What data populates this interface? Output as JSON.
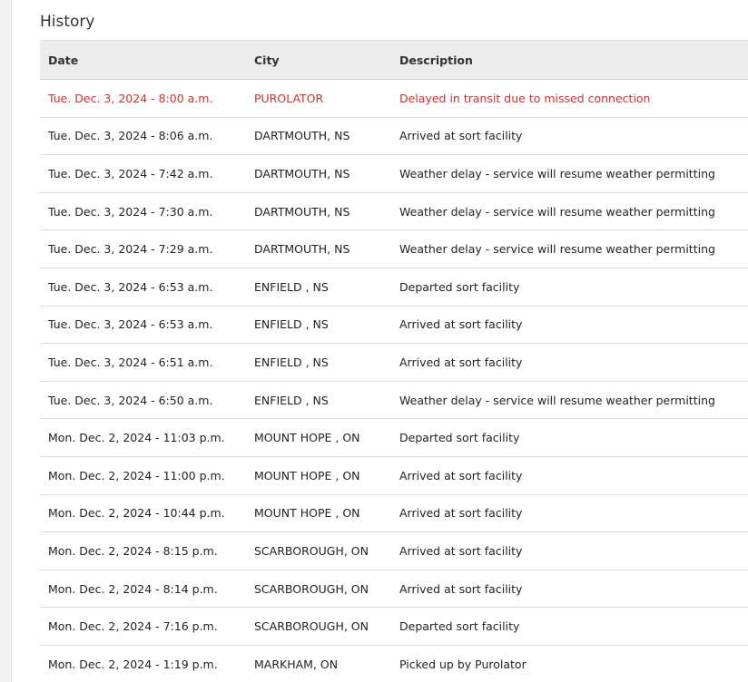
{
  "history": {
    "title": "History",
    "columns": [
      "Date",
      "City",
      "Description"
    ],
    "rows": [
      {
        "date": "Tue. Dec. 3, 2024 - 8:00 a.m.",
        "city": "PUROLATOR",
        "description": "Delayed in transit due to missed connection",
        "alert": true
      },
      {
        "date": "Tue. Dec. 3, 2024 - 8:06 a.m.",
        "city": "DARTMOUTH, NS",
        "description": "Arrived at sort facility"
      },
      {
        "date": "Tue. Dec. 3, 2024 - 7:42 a.m.",
        "city": "DARTMOUTH, NS",
        "description": "Weather delay - service will resume weather permitting"
      },
      {
        "date": "Tue. Dec. 3, 2024 - 7:30 a.m.",
        "city": "DARTMOUTH, NS",
        "description": "Weather delay - service will resume weather permitting"
      },
      {
        "date": "Tue. Dec. 3, 2024 - 7:29 a.m.",
        "city": "DARTMOUTH, NS",
        "description": "Weather delay - service will resume weather permitting"
      },
      {
        "date": "Tue. Dec. 3, 2024 - 6:53 a.m.",
        "city": "ENFIELD , NS",
        "description": "Departed sort facility"
      },
      {
        "date": "Tue. Dec. 3, 2024 - 6:53 a.m.",
        "city": "ENFIELD , NS",
        "description": "Arrived at sort facility"
      },
      {
        "date": "Tue. Dec. 3, 2024 - 6:51 a.m.",
        "city": "ENFIELD , NS",
        "description": "Arrived at sort facility"
      },
      {
        "date": "Tue. Dec. 3, 2024 - 6:50 a.m.",
        "city": "ENFIELD , NS",
        "description": "Weather delay - service will resume weather permitting"
      },
      {
        "date": "Mon. Dec. 2, 2024 - 11:03 p.m.",
        "city": "MOUNT HOPE , ON",
        "description": "Departed sort facility"
      },
      {
        "date": "Mon. Dec. 2, 2024 - 11:00 p.m.",
        "city": "MOUNT HOPE , ON",
        "description": "Arrived at sort facility"
      },
      {
        "date": "Mon. Dec. 2, 2024 - 10:44 p.m.",
        "city": "MOUNT HOPE , ON",
        "description": "Arrived at sort facility"
      },
      {
        "date": "Mon. Dec. 2, 2024 - 8:15 p.m.",
        "city": "SCARBOROUGH, ON",
        "description": "Arrived at sort facility"
      },
      {
        "date": "Mon. Dec. 2, 2024 - 8:14 p.m.",
        "city": "SCARBOROUGH, ON",
        "description": "Arrived at sort facility"
      },
      {
        "date": "Mon. Dec. 2, 2024 - 7:16 p.m.",
        "city": "SCARBOROUGH, ON",
        "description": "Departed sort facility"
      },
      {
        "date": "Mon. Dec. 2, 2024 - 1:19 p.m.",
        "city": "MARKHAM, ON",
        "description": "Picked up by Purolator"
      }
    ]
  },
  "colors": {
    "alert_text": "#d0312d",
    "header_background": "#ececec",
    "row_divider": "#dcdcdc"
  }
}
